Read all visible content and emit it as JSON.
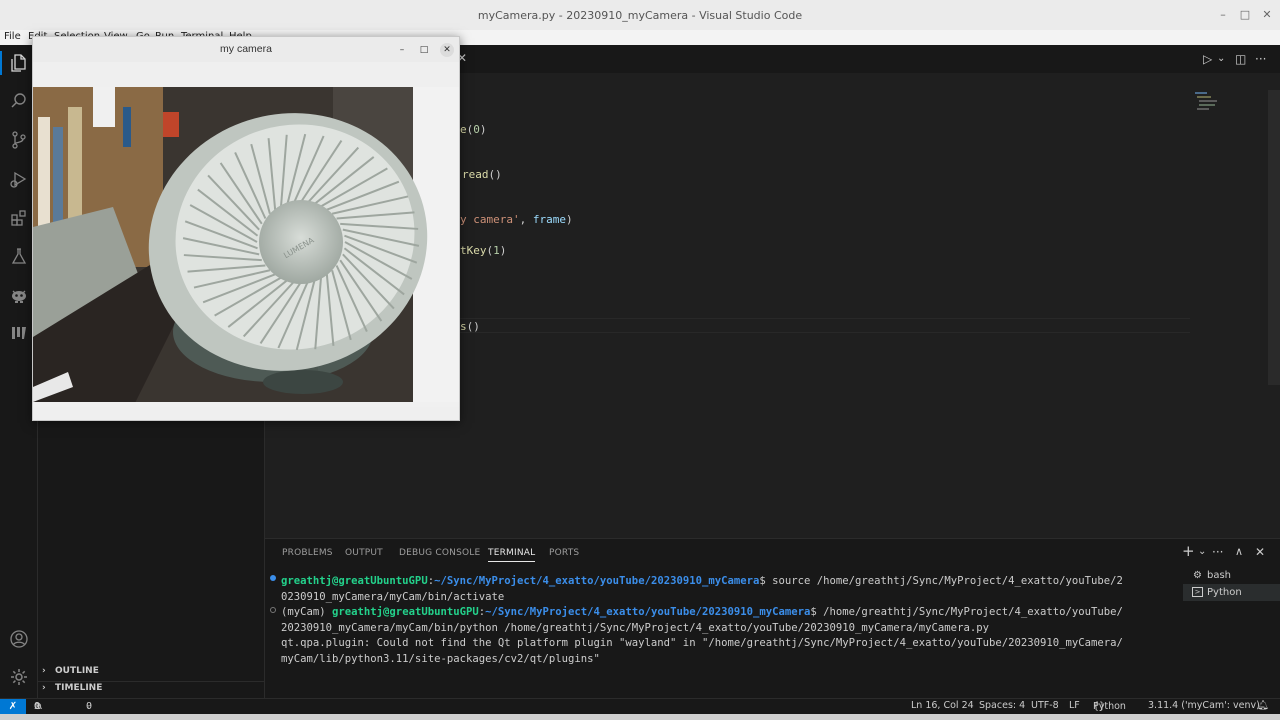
{
  "window": {
    "title": "myCamera.py - 20230910_myCamera - Visual Studio Code",
    "controls": {
      "minimize": "–",
      "maximize": "□",
      "close": "✕"
    }
  },
  "menu": [
    "File",
    "Edit",
    "Selection",
    "View",
    "Go",
    "Run",
    "Terminal",
    "Help"
  ],
  "activitybar": {
    "items": [
      "explorer-icon",
      "search-icon",
      "source-control-icon",
      "run-debug-icon",
      "extensions-icon",
      "testing-icon",
      "robot-icon",
      "bookmark-icon"
    ],
    "bottom": [
      "account-icon",
      "settings-icon"
    ]
  },
  "sidebar": {
    "sections": [
      {
        "label": "OUTLINE"
      },
      {
        "label": "TIMELINE"
      }
    ]
  },
  "editor": {
    "lines": [
      [
        {
          "t": "e",
          "c": "#dcdcaa"
        },
        {
          "t": "(",
          "c": "#cccccc"
        },
        {
          "t": "0",
          "c": "#b5cea8"
        },
        {
          "t": ")",
          "c": "#cccccc"
        }
      ],
      [
        {
          "t": "read",
          "c": "#dcdcaa"
        },
        {
          "t": "()",
          "c": "#cccccc"
        }
      ],
      [
        {
          "t": "y camera'",
          "c": "#ce9178"
        },
        {
          "t": ", ",
          "c": "#cccccc"
        },
        {
          "t": "frame",
          "c": "#9cdcfe"
        },
        {
          "t": ")",
          "c": "#cccccc"
        }
      ],
      [
        {
          "t": "tKey",
          "c": "#dcdcaa"
        },
        {
          "t": "(",
          "c": "#cccccc"
        },
        {
          "t": "1",
          "c": "#b5cea8"
        },
        {
          "t": ")",
          "c": "#cccccc"
        }
      ],
      [
        {
          "t": "s",
          "c": "#dcdcaa"
        },
        {
          "t": "()",
          "c": "#cccccc"
        }
      ]
    ],
    "actions": {
      "run": "▷",
      "run_dropdown": "⌄",
      "split": "◫",
      "more": "···"
    }
  },
  "panel": {
    "tabs": [
      "PROBLEMS",
      "OUTPUT",
      "DEBUG CONSOLE",
      "TERMINAL",
      "PORTS"
    ],
    "active_tab": "TERMINAL",
    "actions": {
      "new": "+",
      "dropdown": "⌄",
      "more": "···",
      "maximize": "∧",
      "close": "✕"
    },
    "terminal_lines": [
      [
        {
          "t": "greathtj@greatUbuntuGPU",
          "k": "g"
        },
        {
          "t": ":"
        },
        {
          "t": "~/Sync/MyProject/4_exatto/youTube/20230910_myCamera",
          "k": "b"
        },
        {
          "t": "$ source /home/greathtj/Sync/MyProject/4_exatto/youTube/2"
        }
      ],
      [
        {
          "t": "0230910_myCamera/myCam/bin/activate"
        }
      ],
      [
        {
          "t": "(myCam) "
        },
        {
          "t": "greathtj@greatUbuntuGPU",
          "k": "g"
        },
        {
          "t": ":"
        },
        {
          "t": "~/Sync/MyProject/4_exatto/youTube/20230910_myCamera",
          "k": "b"
        },
        {
          "t": "$ /home/greathtj/Sync/MyProject/4_exatto/youTube/"
        }
      ],
      [
        {
          "t": "20230910_myCamera/myCam/bin/python /home/greathtj/Sync/MyProject/4_exatto/youTube/20230910_myCamera/myCamera.py"
        }
      ],
      [
        {
          "t": "qt.qpa.plugin: Could not find the Qt platform plugin \"wayland\" in \"/home/greathtj/Sync/MyProject/4_exatto/youTube/20230910_myCamera/"
        }
      ],
      [
        {
          "t": "myCam/lib/python3.11/site-packages/cv2/qt/plugins\""
        }
      ]
    ],
    "terminals": [
      {
        "label": "bash",
        "icon": "bash-terminal-icon"
      },
      {
        "label": "Python",
        "icon": "python-terminal-icon",
        "selected": true
      }
    ]
  },
  "statusbar": {
    "remote": "✗",
    "errors": "0",
    "warnings": "0",
    "ports": "0",
    "position": "Ln 16, Col 24",
    "spaces": "Spaces: 4",
    "encoding": "UTF-8",
    "eol": "LF",
    "language": "Python",
    "interpreter": "3.11.4 ('myCam': venv)"
  },
  "camera_window": {
    "title": "my camera",
    "controls": {
      "minimize": "–",
      "maximize": "□",
      "close": "✕"
    },
    "fan_brand": "LUMENA"
  },
  "colors": {
    "accent": "#0078d4",
    "terminal_green": "#23d18b",
    "terminal_blue": "#3b8eea"
  }
}
